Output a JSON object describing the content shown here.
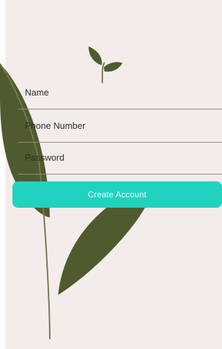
{
  "form": {
    "name_placeholder": "Name",
    "phone_placeholder": "Phone Number",
    "password_placeholder": "Password",
    "create_account_label": "Create Account"
  },
  "colors": {
    "background": "#f3ecea",
    "leaf": "#4f5b2e",
    "button": "#22d2c1",
    "divider": "#8e8a88"
  },
  "icons": {
    "logo": "sprout-icon"
  }
}
